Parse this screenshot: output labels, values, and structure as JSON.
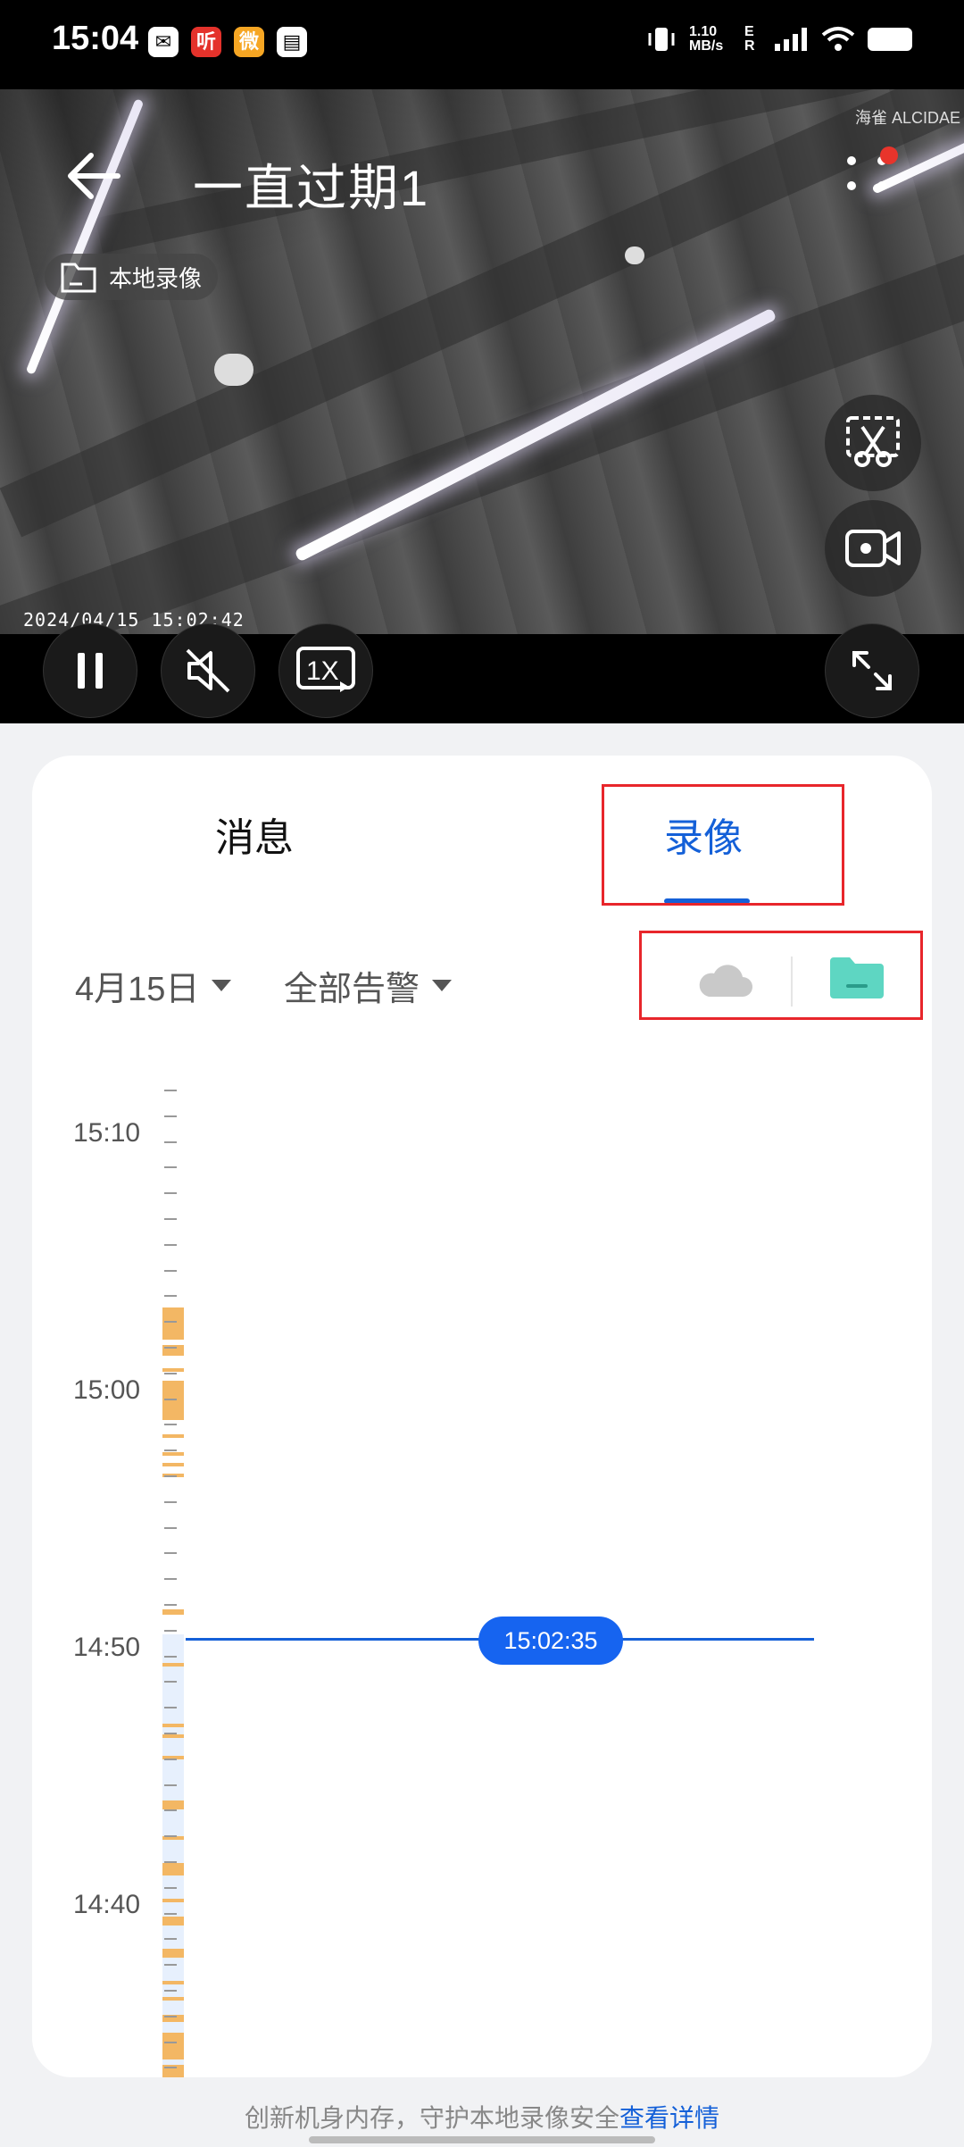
{
  "status_bar": {
    "time": "15:04",
    "app_icons": [
      {
        "name": "mail-icon",
        "glyph": "✉",
        "color": "#ffffff"
      },
      {
        "name": "ting-app-icon",
        "glyph": "听",
        "color": "#e4322b"
      },
      {
        "name": "weibo-icon",
        "glyph": "微",
        "color": "#f6a623"
      },
      {
        "name": "card-icon",
        "glyph": "▤",
        "color": "#ffffff"
      }
    ],
    "net_speed": "1.10 MB/s",
    "net_type": "E R"
  },
  "video": {
    "title": "一直过期1",
    "brand": "海雀 ALCIDAE",
    "local_badge": "本地录像",
    "timestamp": "2024/04/15  15:02:42"
  },
  "tabs": [
    {
      "label": "消息",
      "active": false
    },
    {
      "label": "录像",
      "active": true
    }
  ],
  "filters": {
    "date": "4月15日",
    "alert": "全部告警"
  },
  "timeline": {
    "labels": [
      "15:10",
      "15:00",
      "14:50",
      "14:40"
    ],
    "current_time": "15:02:35"
  },
  "footer": {
    "text": "创新机身内存，守护本地录像安全",
    "link": "查看详情"
  },
  "colors": {
    "accent": "#1460d8",
    "highlight": "#e8262b",
    "recording": "#f3b764",
    "folder": "#5ed6c2"
  }
}
